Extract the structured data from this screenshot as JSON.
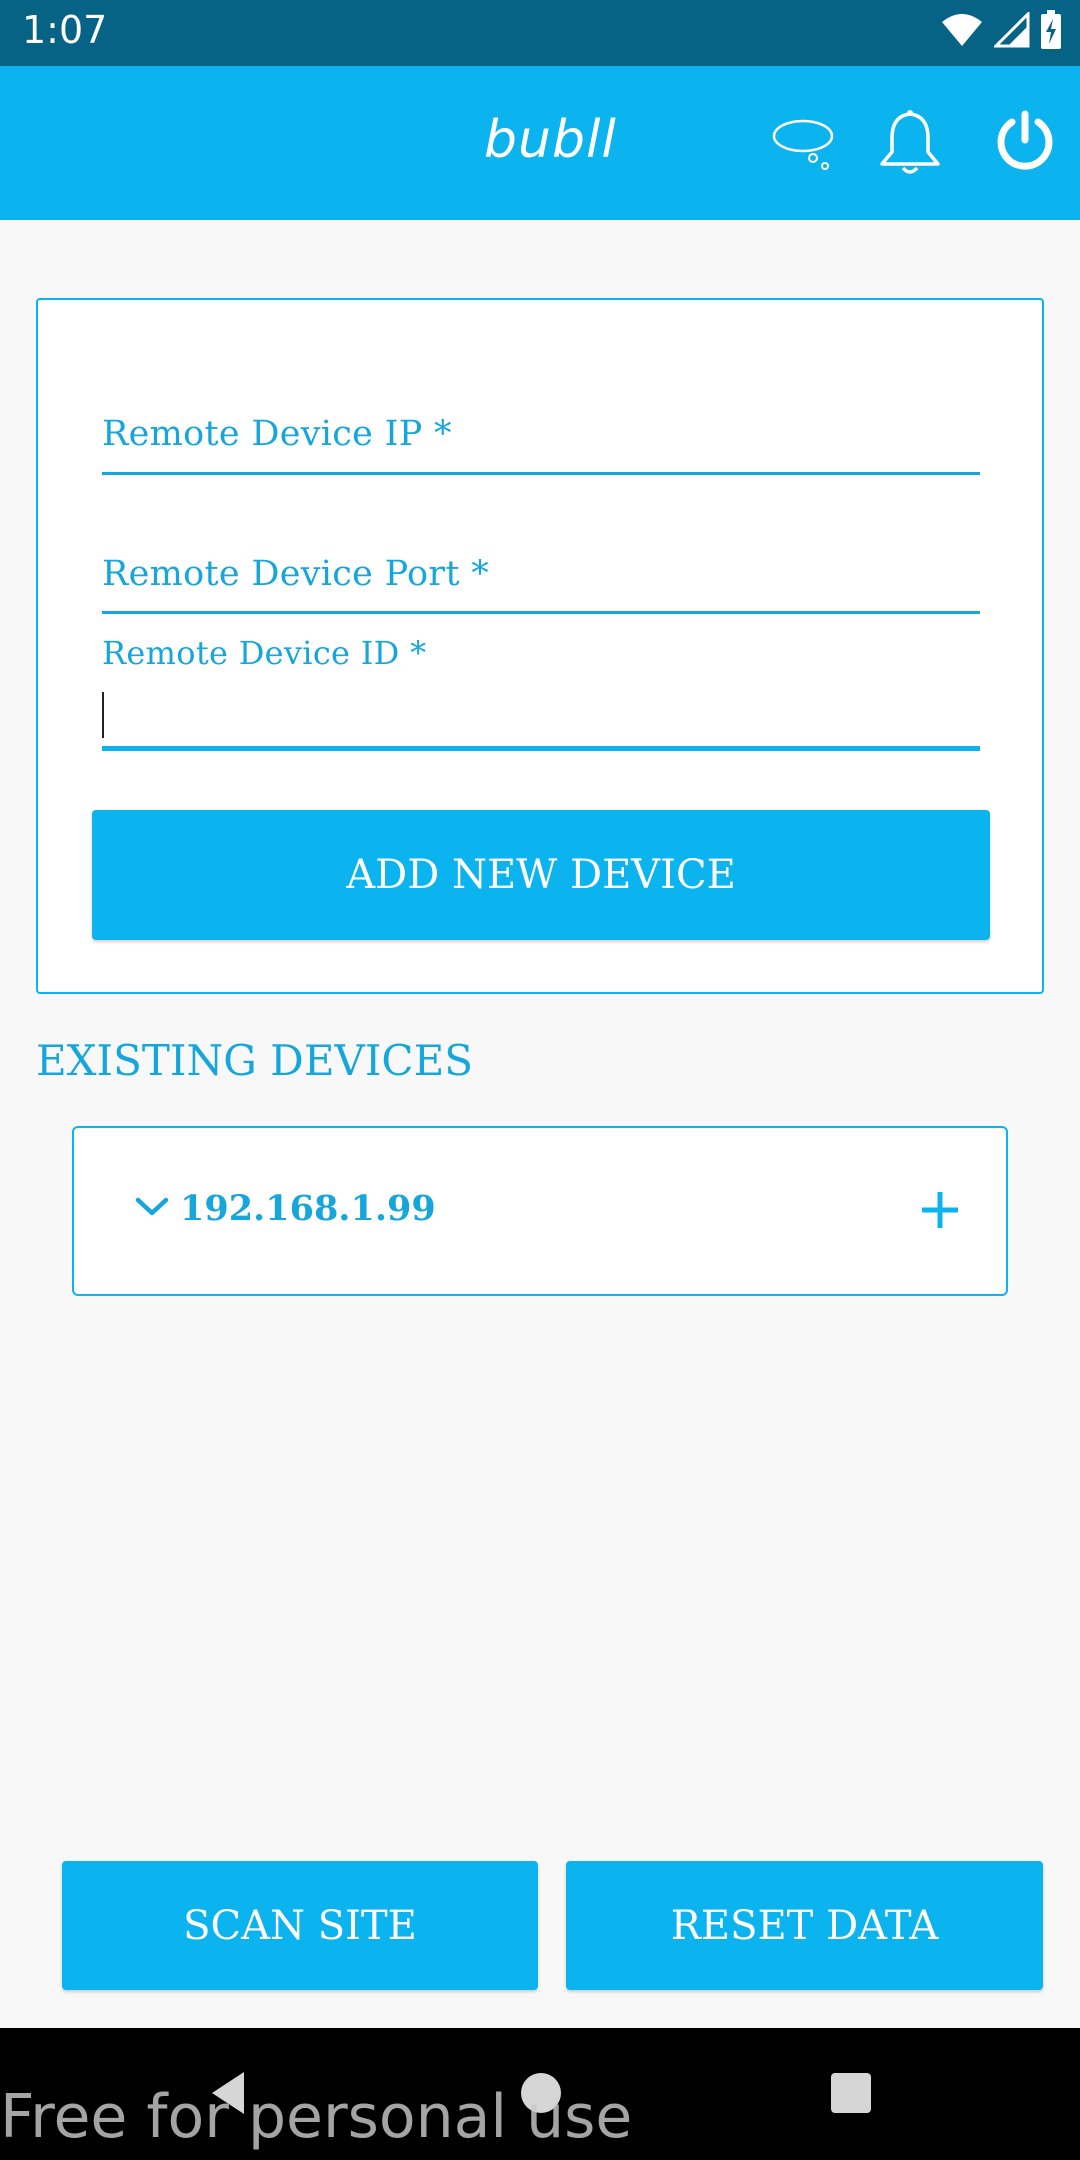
{
  "status_bar": {
    "time": "1:07"
  },
  "app_bar": {
    "logo": "bubll"
  },
  "form": {
    "ip_label": "Remote Device IP *",
    "port_label": "Remote Device Port *",
    "id_label": "Remote Device ID *",
    "id_value": "",
    "add_button": "ADD NEW DEVICE"
  },
  "existing": {
    "title": "EXISTING DEVICES",
    "devices": [
      {
        "ip": "192.168.1.99"
      }
    ]
  },
  "footer": {
    "scan_button": "SCAN SITE",
    "reset_button": "RESET DATA"
  },
  "watermark": "Free for personal use",
  "colors": {
    "accent": "#0cb4ef",
    "status_bar": "#066386",
    "text_accent": "#17a6db",
    "background": "#f8f8f8"
  },
  "icons": [
    "wifi-icon",
    "signal-icon",
    "battery-icon",
    "chat-bubble-icon",
    "bell-icon",
    "power-icon",
    "chevron-down-icon",
    "plus-icon",
    "nav-back-icon",
    "nav-home-icon",
    "nav-recents-icon"
  ]
}
